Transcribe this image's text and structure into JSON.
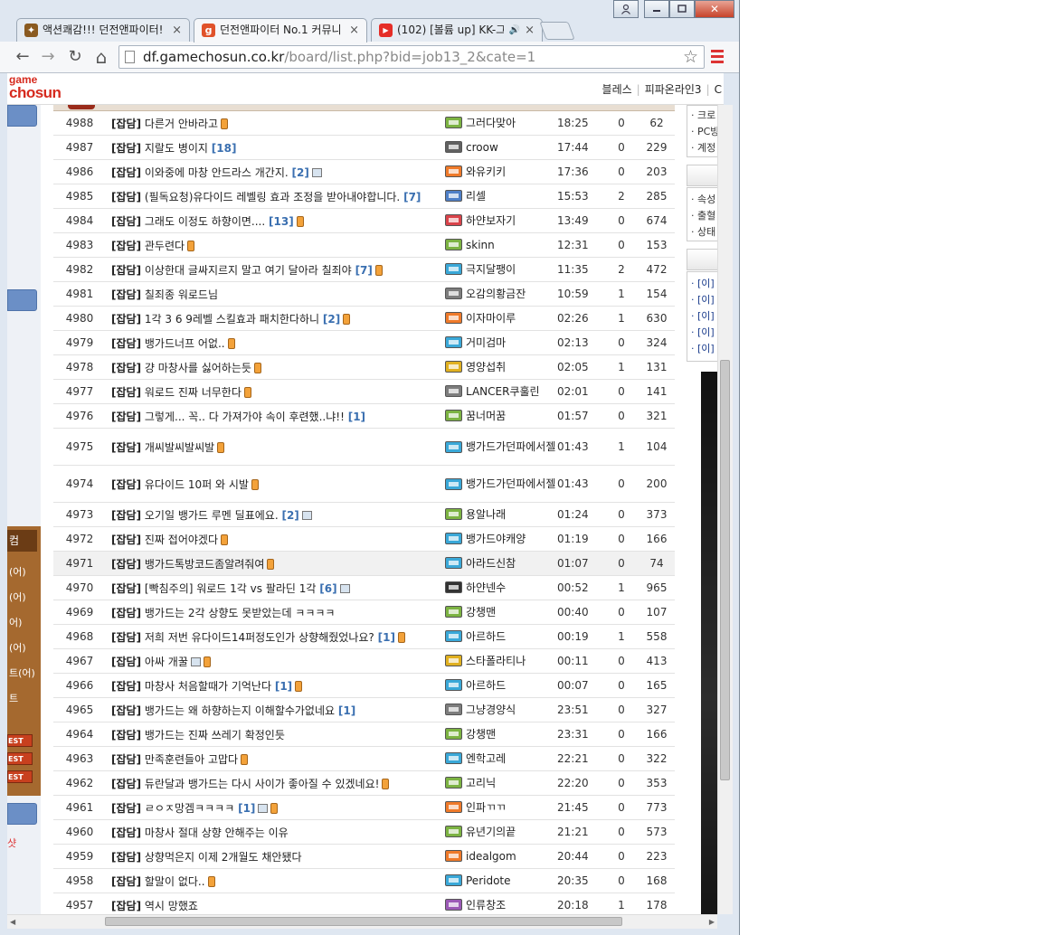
{
  "browser": {
    "tabs": [
      {
        "label": "액션쾌감!!! 던전앤파이터!",
        "favicon_color": "#8a5a20",
        "active": false
      },
      {
        "label": "던전앤파이터 No.1 커뮤니",
        "favicon_color": "#e0522a",
        "active": true
      },
      {
        "label": "(102) [볼륨 up] KK-그",
        "favicon_color": "#e52d27",
        "active": false
      }
    ],
    "tab_close": "×",
    "favicon_game": "g",
    "url_host": "df.gamechosun.co.kr",
    "url_path": "/board/list.php?bid=job13_2&cate=1",
    "back_glyph": "←",
    "forward_glyph": "→",
    "reload_glyph": "↻",
    "home_glyph": "⌂",
    "star_glyph": "☆",
    "window_glyphs": {
      "user": "👤",
      "minimize": "▭",
      "maximize": "□",
      "close": "✕"
    },
    "audio_glyph": "🔊"
  },
  "site": {
    "logo_top": "game",
    "logo_bottom": "chosun",
    "top_links": [
      "블레스",
      "피파온라인3",
      "C"
    ]
  },
  "left_menu": {
    "header": "컴",
    "items": [
      "(어)",
      "(어)",
      "어)",
      "(어)",
      "트(어)",
      "트"
    ],
    "best_labels": [
      "EST",
      "EST",
      "EST"
    ],
    "red_text": "샷"
  },
  "right_panel": {
    "group1": [
      "· 크로",
      "· PC방",
      "· 계정"
    ],
    "group2": [
      "· 속성",
      "· 출혈",
      "· 상태"
    ],
    "group3": [
      "· [이]",
      "· [이]",
      "· [이]",
      "· [이]",
      "· [이]"
    ]
  },
  "posts": [
    {
      "num": "4988",
      "cat": "[잡담]",
      "title": "다른거 안바라고",
      "comments": "",
      "pic": false,
      "mobile": true,
      "author": "그러다맞아",
      "lv": "#7cb342",
      "time": "18:25",
      "rec": "0",
      "views": "62"
    },
    {
      "num": "4987",
      "cat": "[잡담]",
      "title": "지랄도 병이지",
      "comments": "[18]",
      "pic": false,
      "mobile": false,
      "author": "croow",
      "lv": "#616161",
      "time": "17:44",
      "rec": "0",
      "views": "229"
    },
    {
      "num": "4986",
      "cat": "[잡담]",
      "title": "이와중에 마창 안드라스 개간지.",
      "comments": "[2]",
      "pic": true,
      "mobile": false,
      "author": "와유키키",
      "lv": "#ef7a2a",
      "time": "17:36",
      "rec": "0",
      "views": "203"
    },
    {
      "num": "4985",
      "cat": "[잡담]",
      "title": "(필독요청)유다이드 레벨링 효과 조정을 받아내야합니다.",
      "comments": "[7]",
      "pic": false,
      "mobile": false,
      "author": "리셀",
      "lv": "#4e7fc7",
      "time": "15:53",
      "rec": "2",
      "views": "285"
    },
    {
      "num": "4984",
      "cat": "[잡담]",
      "title": "그래도 이정도 하향이면....",
      "comments": "[13]",
      "pic": false,
      "mobile": true,
      "author": "하얀보자기",
      "lv": "#d9434a",
      "time": "13:49",
      "rec": "0",
      "views": "674"
    },
    {
      "num": "4983",
      "cat": "[잡담]",
      "title": "관두련다",
      "comments": "",
      "pic": false,
      "mobile": true,
      "author": "skinn",
      "lv": "#7cb342",
      "time": "12:31",
      "rec": "0",
      "views": "153"
    },
    {
      "num": "4982",
      "cat": "[잡담]",
      "title": "이상한대 글싸지르지 말고 여기 달아라 칠죄야",
      "comments": "[7]",
      "pic": false,
      "mobile": true,
      "author": "극지달팽이",
      "lv": "#3aa8d8",
      "time": "11:35",
      "rec": "2",
      "views": "472"
    },
    {
      "num": "4981",
      "cat": "[잡담]",
      "title": "칠죄종 워로드님",
      "comments": "",
      "pic": false,
      "mobile": false,
      "author": "오감의황금잔",
      "lv": "#7d7d7d",
      "time": "10:59",
      "rec": "1",
      "views": "154"
    },
    {
      "num": "4980",
      "cat": "[잡담]",
      "title": "1각 3 6 9레벨 스킬효과 패치한다하니",
      "comments": "[2]",
      "pic": false,
      "mobile": true,
      "author": "이자마이루",
      "lv": "#ef7a2a",
      "time": "02:26",
      "rec": "1",
      "views": "630"
    },
    {
      "num": "4979",
      "cat": "[잡담]",
      "title": "뱅가드너프 어없..",
      "comments": "",
      "pic": false,
      "mobile": true,
      "author": "거미검마",
      "lv": "#3aa8d8",
      "time": "02:13",
      "rec": "0",
      "views": "324"
    },
    {
      "num": "4978",
      "cat": "[잡담]",
      "title": "걍 마창사를 싫어하는듯",
      "comments": "",
      "pic": false,
      "mobile": true,
      "author": "영양섭취",
      "lv": "#e0b020",
      "time": "02:05",
      "rec": "1",
      "views": "131"
    },
    {
      "num": "4977",
      "cat": "[잡담]",
      "title": "워로드 진짜 너무한다",
      "comments": "",
      "pic": false,
      "mobile": true,
      "author": "LANCER쿠훌린",
      "lv": "#7d7d7d",
      "time": "02:01",
      "rec": "0",
      "views": "141"
    },
    {
      "num": "4976",
      "cat": "[잡담]",
      "title": "그렇게... 꼭.. 다 가져가야 속이 후련했..냐!!",
      "comments": "[1]",
      "pic": false,
      "mobile": false,
      "author": "꿈너머꿈",
      "lv": "#7cb342",
      "time": "01:57",
      "rec": "0",
      "views": "321"
    },
    {
      "num": "4975",
      "cat": "[잡담]",
      "title": "개씨발씨발씨발",
      "comments": "",
      "pic": false,
      "mobile": true,
      "author": "뱅가드가던파에서젤",
      "lv": "#3aa8d8",
      "time": "01:43",
      "rec": "1",
      "views": "104",
      "tall": true
    },
    {
      "num": "4974",
      "cat": "[잡담]",
      "title": "유다이드 10퍼 와 시발",
      "comments": "",
      "pic": false,
      "mobile": true,
      "author": "뱅가드가던파에서젤",
      "lv": "#3aa8d8",
      "time": "01:43",
      "rec": "0",
      "views": "200",
      "tall": true
    },
    {
      "num": "4973",
      "cat": "[잡담]",
      "title": "오기일 뱅가드 루멘 딜표에요.",
      "comments": "[2]",
      "pic": true,
      "mobile": false,
      "author": "용알나래",
      "lv": "#7cb342",
      "time": "01:24",
      "rec": "0",
      "views": "373"
    },
    {
      "num": "4972",
      "cat": "[잡담]",
      "title": "진짜 접어야겠다",
      "comments": "",
      "pic": false,
      "mobile": true,
      "author": "뱅가드야캐양",
      "lv": "#3aa8d8",
      "time": "01:19",
      "rec": "0",
      "views": "166"
    },
    {
      "num": "4971",
      "cat": "[잡담]",
      "title": "뱅가드톡방코드좀알려줘여",
      "comments": "",
      "pic": false,
      "mobile": true,
      "author": "아라드신참",
      "lv": "#3aa8d8",
      "time": "01:07",
      "rec": "0",
      "views": "74",
      "highlight": true
    },
    {
      "num": "4970",
      "cat": "[잡담]",
      "title": "[빡침주의] 워로드 1각 vs 팔라딘 1각",
      "comments": "[6]",
      "pic": true,
      "mobile": false,
      "author": "하얀넨수",
      "lv": "#333333",
      "time": "00:52",
      "rec": "1",
      "views": "965"
    },
    {
      "num": "4969",
      "cat": "[잡담]",
      "title": "뱅가드는 2각 상향도 못받았는데 ㅋㅋㅋㅋ",
      "comments": "",
      "pic": false,
      "mobile": false,
      "author": "강챙맨",
      "lv": "#7cb342",
      "time": "00:40",
      "rec": "0",
      "views": "107"
    },
    {
      "num": "4968",
      "cat": "[잡담]",
      "title": "저희 저번 유다이드14퍼정도인가 상향해줬었나요?",
      "comments": "[1]",
      "pic": false,
      "mobile": true,
      "author": "아르하드",
      "lv": "#3aa8d8",
      "time": "00:19",
      "rec": "1",
      "views": "558"
    },
    {
      "num": "4967",
      "cat": "[잡담]",
      "title": "아싸 개꿀",
      "comments": "",
      "pic": true,
      "mobile": true,
      "author": "스타폴라티나",
      "lv": "#e0b020",
      "time": "00:11",
      "rec": "0",
      "views": "413"
    },
    {
      "num": "4966",
      "cat": "[잡담]",
      "title": "마창사 처음할때가 기억난다",
      "comments": "[1]",
      "pic": false,
      "mobile": true,
      "author": "아르하드",
      "lv": "#3aa8d8",
      "time": "00:07",
      "rec": "0",
      "views": "165"
    },
    {
      "num": "4965",
      "cat": "[잡담]",
      "title": "뱅가드는 왜 하향하는지 이해할수가없네요",
      "comments": "[1]",
      "pic": false,
      "mobile": false,
      "author": "그냥경양식",
      "lv": "#7d7d7d",
      "time": "23:51",
      "rec": "0",
      "views": "327"
    },
    {
      "num": "4964",
      "cat": "[잡담]",
      "title": "뱅가드는 진짜 쓰레기 확정인듯",
      "comments": "",
      "pic": false,
      "mobile": false,
      "author": "강챙맨",
      "lv": "#7cb342",
      "time": "23:31",
      "rec": "0",
      "views": "166"
    },
    {
      "num": "4963",
      "cat": "[잡담]",
      "title": "만족훈련들아 고맙다",
      "comments": "",
      "pic": false,
      "mobile": true,
      "author": "엔학고레",
      "lv": "#3aa8d8",
      "time": "22:21",
      "rec": "0",
      "views": "322"
    },
    {
      "num": "4962",
      "cat": "[잡담]",
      "title": "듀란달과 뱅가드는 다시 사이가 좋아질 수 있겠네요!",
      "comments": "",
      "pic": false,
      "mobile": true,
      "author": "고리닉",
      "lv": "#7cb342",
      "time": "22:20",
      "rec": "0",
      "views": "353"
    },
    {
      "num": "4961",
      "cat": "[잡담]",
      "title": "ㄹㅇㅈ망겜ㅋㅋㅋㅋ",
      "comments": "[1]",
      "pic": true,
      "mobile": true,
      "author": "인파ㄲㄲ",
      "lv": "#ef7a2a",
      "time": "21:45",
      "rec": "0",
      "views": "773"
    },
    {
      "num": "4960",
      "cat": "[잡담]",
      "title": "마창사 절대 상향 안해주는 이유",
      "comments": "",
      "pic": false,
      "mobile": false,
      "author": "유년기의끝",
      "lv": "#7cb342",
      "time": "21:21",
      "rec": "0",
      "views": "573"
    },
    {
      "num": "4959",
      "cat": "[잡담]",
      "title": "상향먹은지 이제 2개월도 채안됐다",
      "comments": "",
      "pic": false,
      "mobile": false,
      "author": "idealgom",
      "lv": "#ef7a2a",
      "time": "20:44",
      "rec": "0",
      "views": "223"
    },
    {
      "num": "4958",
      "cat": "[잡담]",
      "title": "할말이 없다..",
      "comments": "",
      "pic": false,
      "mobile": true,
      "author": "Peridote",
      "lv": "#3aa8d8",
      "time": "20:35",
      "rec": "0",
      "views": "168"
    },
    {
      "num": "4957",
      "cat": "[잡담]",
      "title": "역시 망했죠",
      "comments": "",
      "pic": false,
      "mobile": false,
      "author": "인류창조",
      "lv": "#9b59b6",
      "time": "20:18",
      "rec": "1",
      "views": "178"
    }
  ]
}
